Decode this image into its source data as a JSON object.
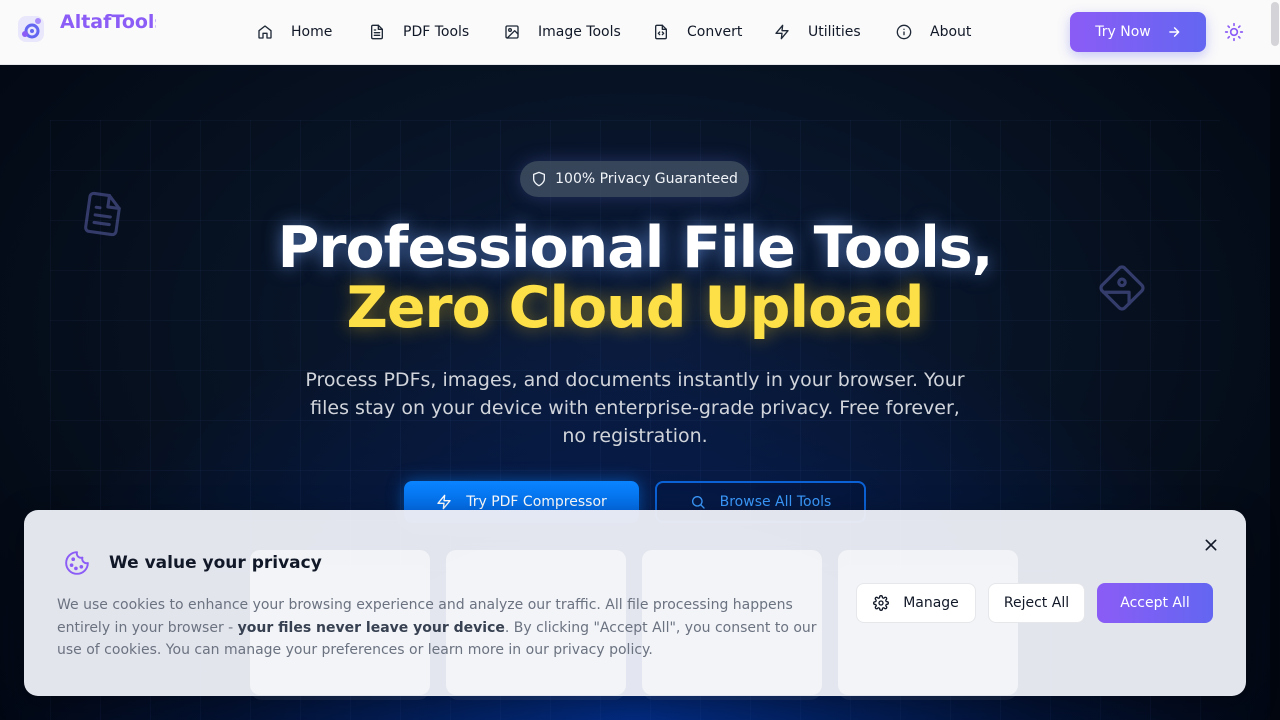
{
  "brand": {
    "name": "AltafTools",
    "accent": "#8b5cf6"
  },
  "nav": {
    "items": [
      {
        "label": "Home",
        "icon": "home-icon"
      },
      {
        "label": "PDF Tools",
        "icon": "file-text-icon"
      },
      {
        "label": "Image Tools",
        "icon": "image-icon"
      },
      {
        "label": "Convert",
        "icon": "file-convert-icon"
      },
      {
        "label": "Utilities",
        "icon": "zap-icon"
      },
      {
        "label": "About",
        "icon": "info-icon"
      }
    ],
    "try_now": "Try Now"
  },
  "hero": {
    "badge": "100% Privacy Guaranteed",
    "title_line1": "Professional File Tools,",
    "title_line2": "Zero Cloud Upload",
    "subtitle": "Process PDFs, images, and documents instantly in your browser. Your files stay on your device with enterprise-grade privacy. Free forever, no registration.",
    "cta_primary": "Try PDF Compressor",
    "cta_secondary": "Browse All Tools",
    "title_color": "#ffffff",
    "highlight_color": "#fde047"
  },
  "cookie": {
    "title": "We value your privacy",
    "text_before": "We use cookies to enhance your browsing experience and analyze our traffic. All file processing happens entirely in your browser - ",
    "text_bold": "your files never leave your device",
    "text_after": ". By clicking \"Accept All\", you consent to our use of cookies. You can manage your preferences or learn more in our privacy policy.",
    "manage": "Manage",
    "reject": "Reject All",
    "accept": "Accept All"
  }
}
